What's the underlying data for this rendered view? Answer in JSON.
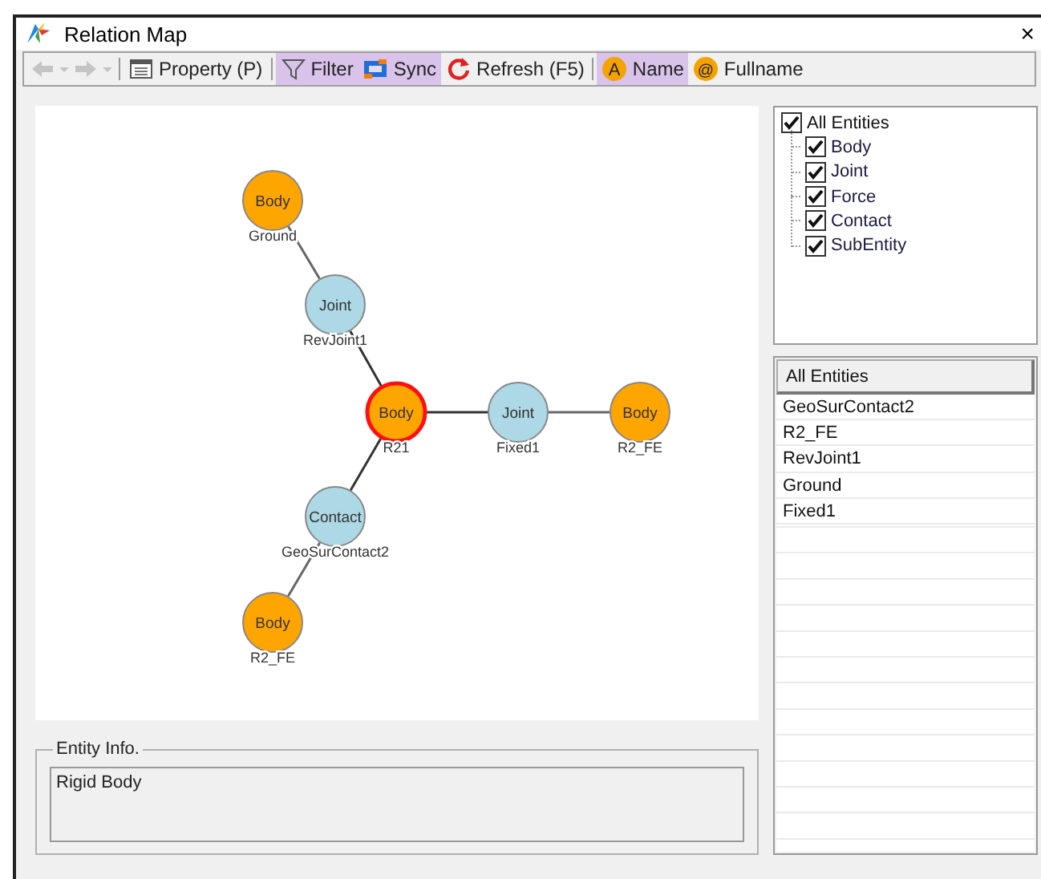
{
  "window": {
    "title": "Relation Map",
    "close": "×"
  },
  "toolbar": [
    {
      "kind": "back",
      "disabled": true
    },
    {
      "kind": "menu",
      "disabled": true
    },
    {
      "kind": "forward",
      "disabled": true
    },
    {
      "kind": "menu",
      "disabled": true
    },
    {
      "kind": "separator"
    },
    {
      "kind": "property",
      "label": "Property (P)",
      "on": false
    },
    {
      "kind": "separator"
    },
    {
      "kind": "filter",
      "label": "Filter",
      "on": true
    },
    {
      "kind": "sync",
      "label": "Sync",
      "on": true
    },
    {
      "kind": "refresh",
      "label": "Refresh (F5)",
      "on": false
    },
    {
      "kind": "separator"
    },
    {
      "kind": "name",
      "label": "Name",
      "glyph": "A",
      "on": true
    },
    {
      "kind": "fullname",
      "label": "Fullname",
      "glyph": "@",
      "on": false
    }
  ],
  "graph": {
    "kind": "body",
    "type_label": "Body",
    "name": "R21",
    "selected": true,
    "children": [
      {
        "kind": "link",
        "type_label": "Joint",
        "name": "RevJoint1",
        "selected": false,
        "children": [
          {
            "kind": "body",
            "type_label": "Body",
            "name": "Ground",
            "selected": false
          }
        ]
      },
      {
        "kind": "link",
        "type_label": "Joint",
        "name": "Fixed1",
        "selected": false,
        "children": [
          {
            "kind": "body",
            "type_label": "Body",
            "name": "R2_FE",
            "selected": false
          }
        ]
      },
      {
        "kind": "link",
        "type_label": "Contact",
        "name": "GeoSurContact2",
        "selected": false,
        "children": [
          {
            "kind": "body",
            "type_label": "Body",
            "name": "R2_FE",
            "selected": false
          }
        ]
      }
    ]
  },
  "filter_tree": {
    "label": "All Entities",
    "checked": true,
    "children": [
      {
        "label": "Body",
        "checked": true
      },
      {
        "label": "Joint",
        "checked": true
      },
      {
        "label": "Force",
        "checked": true
      },
      {
        "label": "Contact",
        "checked": true
      },
      {
        "label": "SubEntity",
        "checked": true
      }
    ]
  },
  "entity_list": {
    "header": "All Entities",
    "rows": [
      "GeoSurContact2",
      "R2_FE",
      "RevJoint1",
      "Ground",
      "Fixed1"
    ]
  },
  "entity_info": {
    "title": "Entity Info.",
    "value": "Rigid Body"
  }
}
